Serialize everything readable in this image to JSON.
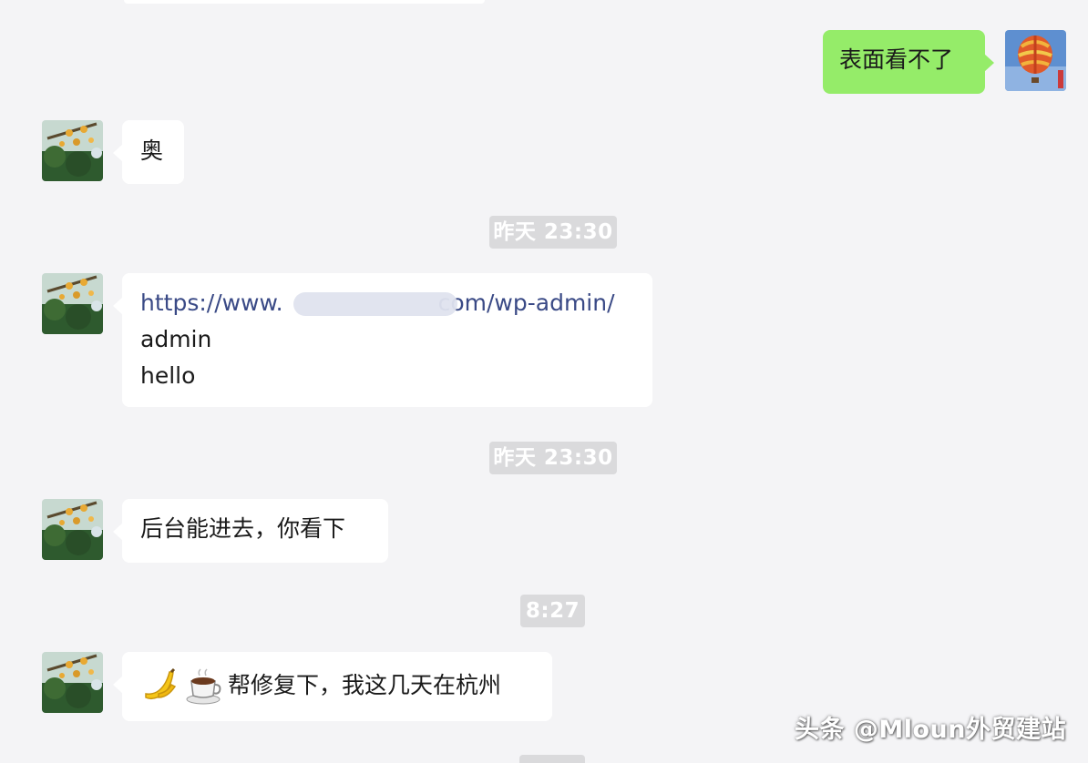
{
  "messages": [
    {
      "side": "right",
      "type": "text",
      "text": "表面看不了"
    },
    {
      "side": "left",
      "type": "text",
      "text": "奥"
    },
    {
      "type": "timestamp",
      "text": "昨天 23:30"
    },
    {
      "side": "left",
      "type": "multiline",
      "link": "https://www.",
      "link_suffix": "com/wp-admin/",
      "lines": [
        "admin",
        "hello"
      ]
    },
    {
      "type": "timestamp",
      "text": "昨天 23:30"
    },
    {
      "side": "left",
      "type": "text",
      "text": "后台能进去，你看下"
    },
    {
      "type": "timestamp",
      "text": "8:27"
    },
    {
      "side": "left",
      "type": "emoji-text",
      "emojis": [
        "banana-icon",
        "coffee-icon"
      ],
      "text": "帮修复下，我这几天在杭州"
    }
  ],
  "watermark": "头条 @Mloun外贸建站",
  "colors": {
    "background": "#f4f4f6",
    "incoming_bubble": "#ffffff",
    "outgoing_bubble": "#95ec69",
    "timestamp_bg": "#dadadc",
    "link": "#3a4a86"
  }
}
